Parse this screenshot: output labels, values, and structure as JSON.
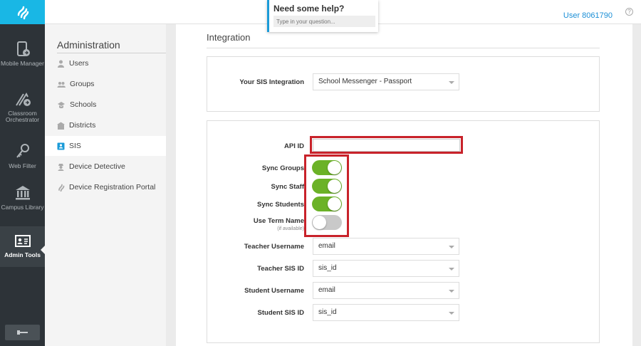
{
  "rail": {
    "items": [
      {
        "label": "Mobile Manager",
        "icon": "mobile-manager-icon"
      },
      {
        "label": "Classroom Orchestrator",
        "icon": "classroom-orchestrator-icon"
      },
      {
        "label": "Web Filter",
        "icon": "web-filter-icon"
      },
      {
        "label": "Campus Library",
        "icon": "campus-library-icon"
      },
      {
        "label": "Admin Tools",
        "icon": "admin-tools-icon"
      }
    ],
    "active": "Admin Tools"
  },
  "topbar": {
    "user": "User 8061790",
    "help_icon": "?"
  },
  "help": {
    "title": "Need some help?",
    "placeholder": "Type in your question..."
  },
  "admin_nav": {
    "title": "Administration",
    "items": [
      {
        "label": "Users",
        "icon": "user-icon"
      },
      {
        "label": "Groups",
        "icon": "groups-icon"
      },
      {
        "label": "Schools",
        "icon": "school-icon"
      },
      {
        "label": "Districts",
        "icon": "district-icon"
      },
      {
        "label": "SIS",
        "icon": "sis-icon"
      },
      {
        "label": "Device Detective",
        "icon": "device-detective-icon"
      },
      {
        "label": "Device Registration Portal",
        "icon": "registration-portal-icon"
      }
    ],
    "active": "SIS"
  },
  "integration": {
    "title": "Integration",
    "sis_label": "Your SIS Integration",
    "sis_value": "School Messenger - Passport",
    "api_id_label": "API ID",
    "api_id_value": "",
    "toggles": [
      {
        "label": "Sync Groups",
        "on": true
      },
      {
        "label": "Sync Staff",
        "on": true
      },
      {
        "label": "Sync Students",
        "on": true
      },
      {
        "label": "Use Term Name",
        "sub": "(if available)",
        "on": false
      }
    ],
    "selects": [
      {
        "label": "Teacher Username",
        "value": "email"
      },
      {
        "label": "Teacher SIS ID",
        "value": "sis_id"
      },
      {
        "label": "Student Username",
        "value": "email"
      },
      {
        "label": "Student SIS ID",
        "value": "sis_id"
      }
    ]
  },
  "colors": {
    "rail_bg": "#2d3338",
    "brand_blue": "#19b7e5",
    "toggle_on": "#6bb227",
    "highlight_red": "#c8222a",
    "link_blue": "#1b8fd6"
  }
}
